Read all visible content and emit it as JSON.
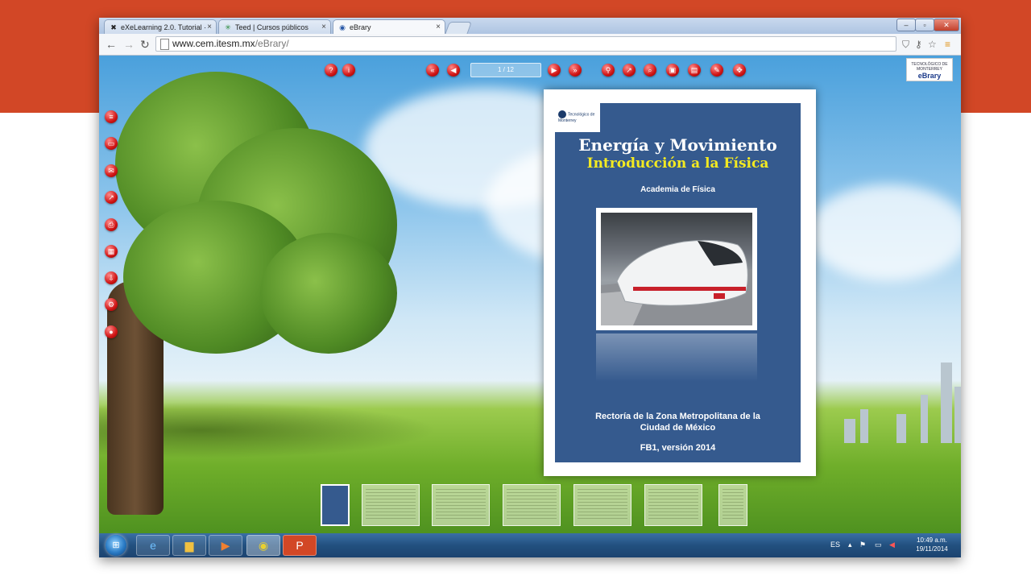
{
  "browser": {
    "tabs": [
      {
        "label": "eXeLearning 2.0. Tutorial ·",
        "icon": "exe-icon"
      },
      {
        "label": "Teed | Cursos públicos",
        "icon": "teed-icon"
      },
      {
        "label": "eBrary",
        "icon": "ebrary-icon"
      }
    ],
    "url_host": "www.cem.itesm.mx",
    "url_path": "/eBrary/"
  },
  "reader": {
    "page_indicator": "1 / 12",
    "logo_line1": "TECNOLÓGICO DE MONTERREY",
    "logo_line2": "eBrary"
  },
  "cover": {
    "logo_text": "Tecnológico de Monterrey",
    "title": "Energía y Movimiento",
    "subtitle": "Introducción a la Física",
    "academy": "Academia de Física",
    "rectoria_line1": "Rectoría de la Zona Metropolitana de la",
    "rectoria_line2": "Ciudad de México",
    "version": "FB1, versión 2014"
  },
  "taskbar": {
    "language": "ES",
    "time": "10:49 a.m.",
    "date": "19/11/2014"
  },
  "colors": {
    "accent_band": "#d24726",
    "cover_blue": "#355a8e",
    "subtitle_yellow": "#f3ea21",
    "reader_button_red": "#d01515"
  }
}
